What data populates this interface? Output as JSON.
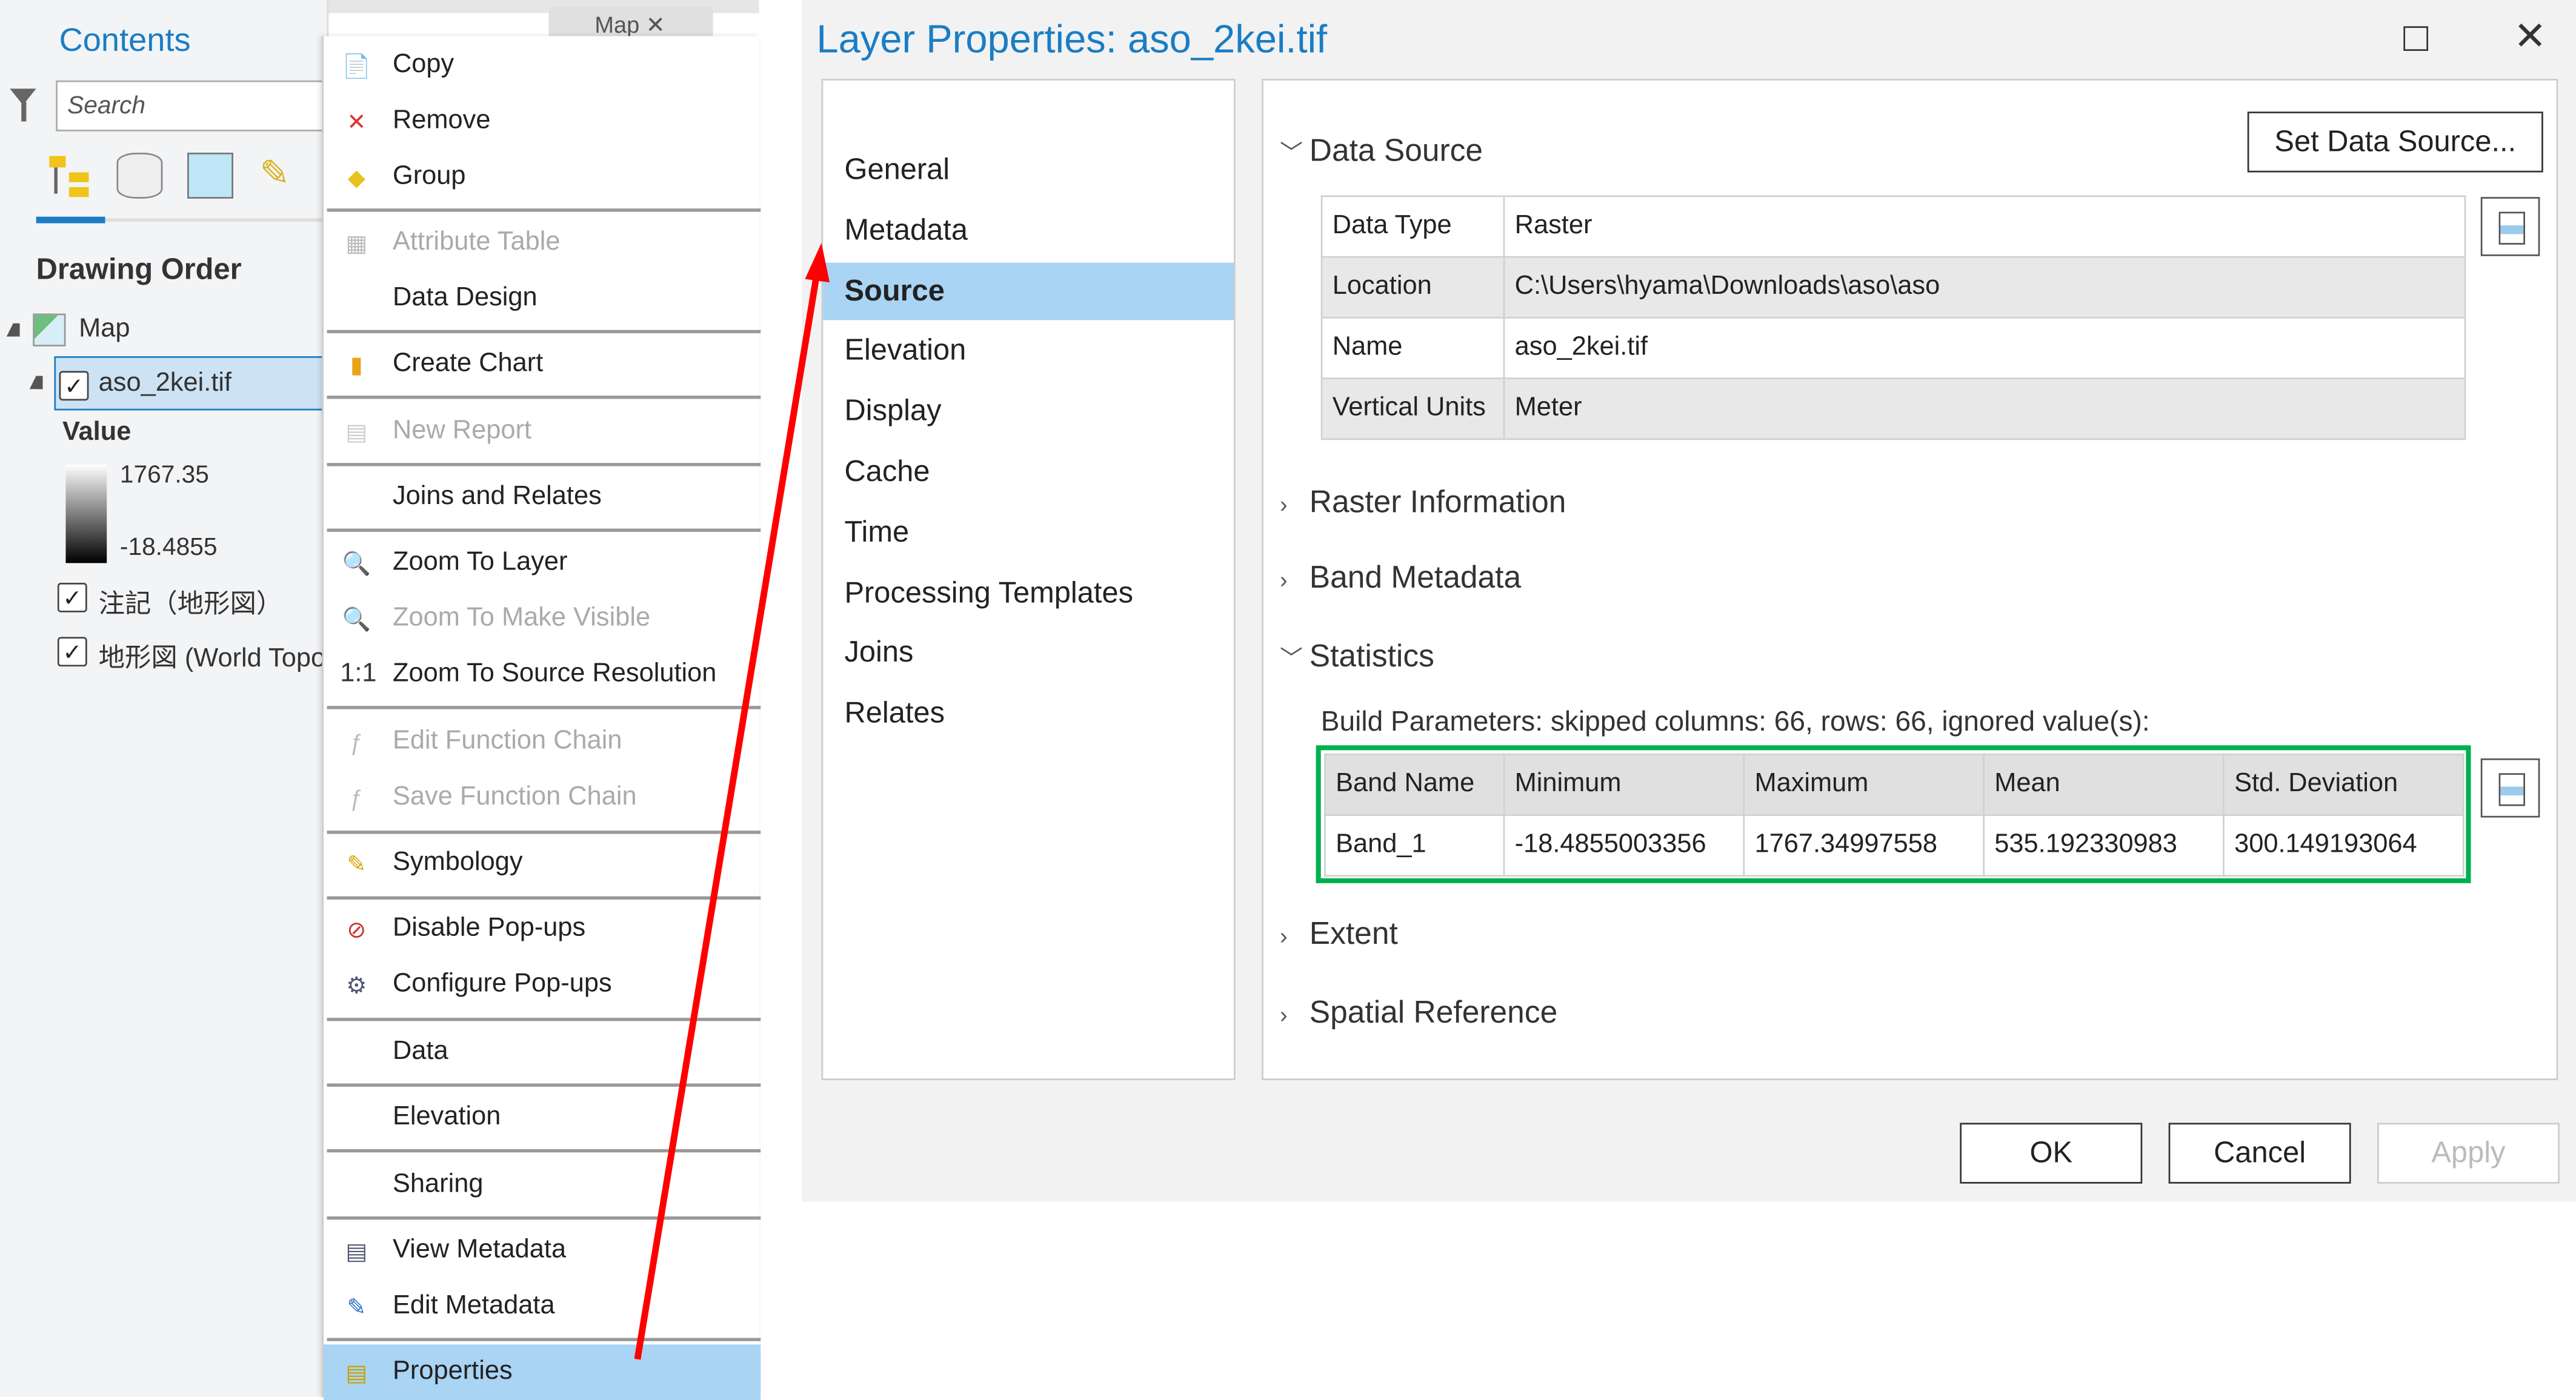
{
  "contents": {
    "title": "Contents",
    "map_tab": "Map",
    "search_placeholder": "Search",
    "drawing_order": "Drawing Order",
    "map_label": "Map",
    "layer": "aso_2kei.tif",
    "value_label": "Value",
    "legend_max": "1767.35",
    "legend_min": "-18.4855",
    "layer2": "注記（地形図）",
    "layer3": "地形図 (World Topo"
  },
  "menu": {
    "items": [
      {
        "label": "Copy",
        "icon": "copy-icon",
        "disabled": false
      },
      {
        "label": "Remove",
        "icon": "remove-icon",
        "disabled": false
      },
      {
        "label": "Group",
        "icon": "group-icon",
        "disabled": false
      },
      {
        "label": "Attribute Table",
        "icon": "table-icon",
        "disabled": true
      },
      {
        "label": "Data Design",
        "icon": "",
        "disabled": false
      },
      {
        "label": "Create Chart",
        "icon": "chart-icon",
        "disabled": false
      },
      {
        "label": "New Report",
        "icon": "report-icon",
        "disabled": true
      },
      {
        "label": "Joins and Relates",
        "icon": "",
        "disabled": false
      },
      {
        "label": "Zoom To Layer",
        "icon": "zoom-layer-icon",
        "disabled": false
      },
      {
        "label": "Zoom To Make Visible",
        "icon": "zoom-visible-icon",
        "disabled": true
      },
      {
        "label": "Zoom To Source Resolution",
        "icon": "one-to-one-icon",
        "disabled": false
      },
      {
        "label": "Edit Function Chain",
        "icon": "function-icon",
        "disabled": true
      },
      {
        "label": "Save Function Chain",
        "icon": "function-icon",
        "disabled": true
      },
      {
        "label": "Symbology",
        "icon": "symbology-icon",
        "disabled": false
      },
      {
        "label": "Disable Pop-ups",
        "icon": "disable-popups-icon",
        "disabled": false
      },
      {
        "label": "Configure Pop-ups",
        "icon": "configure-popups-icon",
        "disabled": false
      },
      {
        "label": "Data",
        "icon": "",
        "disabled": false
      },
      {
        "label": "Elevation",
        "icon": "",
        "disabled": false
      },
      {
        "label": "Sharing",
        "icon": "",
        "disabled": false
      },
      {
        "label": "View Metadata",
        "icon": "metadata-icon",
        "disabled": false
      },
      {
        "label": "Edit Metadata",
        "icon": "pencil-icon",
        "disabled": false
      },
      {
        "label": "Properties",
        "icon": "properties-icon",
        "disabled": false,
        "selected": true
      }
    ]
  },
  "dialog": {
    "title": "Layer Properties: aso_2kei.tif",
    "nav": [
      "General",
      "Metadata",
      "Source",
      "Elevation",
      "Display",
      "Cache",
      "Time",
      "Processing Templates",
      "Joins",
      "Relates"
    ],
    "selected_nav": "Source",
    "set_data_source": "Set Data Source...",
    "data_source_header": "Data Source",
    "data_source": [
      {
        "label": "Data Type",
        "value": "Raster"
      },
      {
        "label": "Location",
        "value": "C:\\Users\\hyama\\Downloads\\aso\\aso"
      },
      {
        "label": "Name",
        "value": "aso_2kei.tif"
      },
      {
        "label": "Vertical Units",
        "value": "Meter"
      }
    ],
    "raster_information": "Raster Information",
    "band_metadata": "Band Metadata",
    "statistics": "Statistics",
    "build_parameters": "Build Parameters: skipped columns: 66, rows: 66, ignored value(s):",
    "stats_headers": [
      "Band Name",
      "Minimum",
      "Maximum",
      "Mean",
      "Std. Deviation"
    ],
    "stats_row": [
      "Band_1",
      "-18.4855003356",
      "1767.34997558",
      "535.192330983",
      "300.149193064"
    ],
    "extent": "Extent",
    "spatial_reference": "Spatial Reference",
    "ok": "OK",
    "cancel": "Cancel",
    "apply": "Apply"
  },
  "colors": {
    "accent": "#1a7dc4",
    "selection": "#a9d4f3",
    "highlight_box": "#00b050",
    "arrow": "#ff0000"
  }
}
